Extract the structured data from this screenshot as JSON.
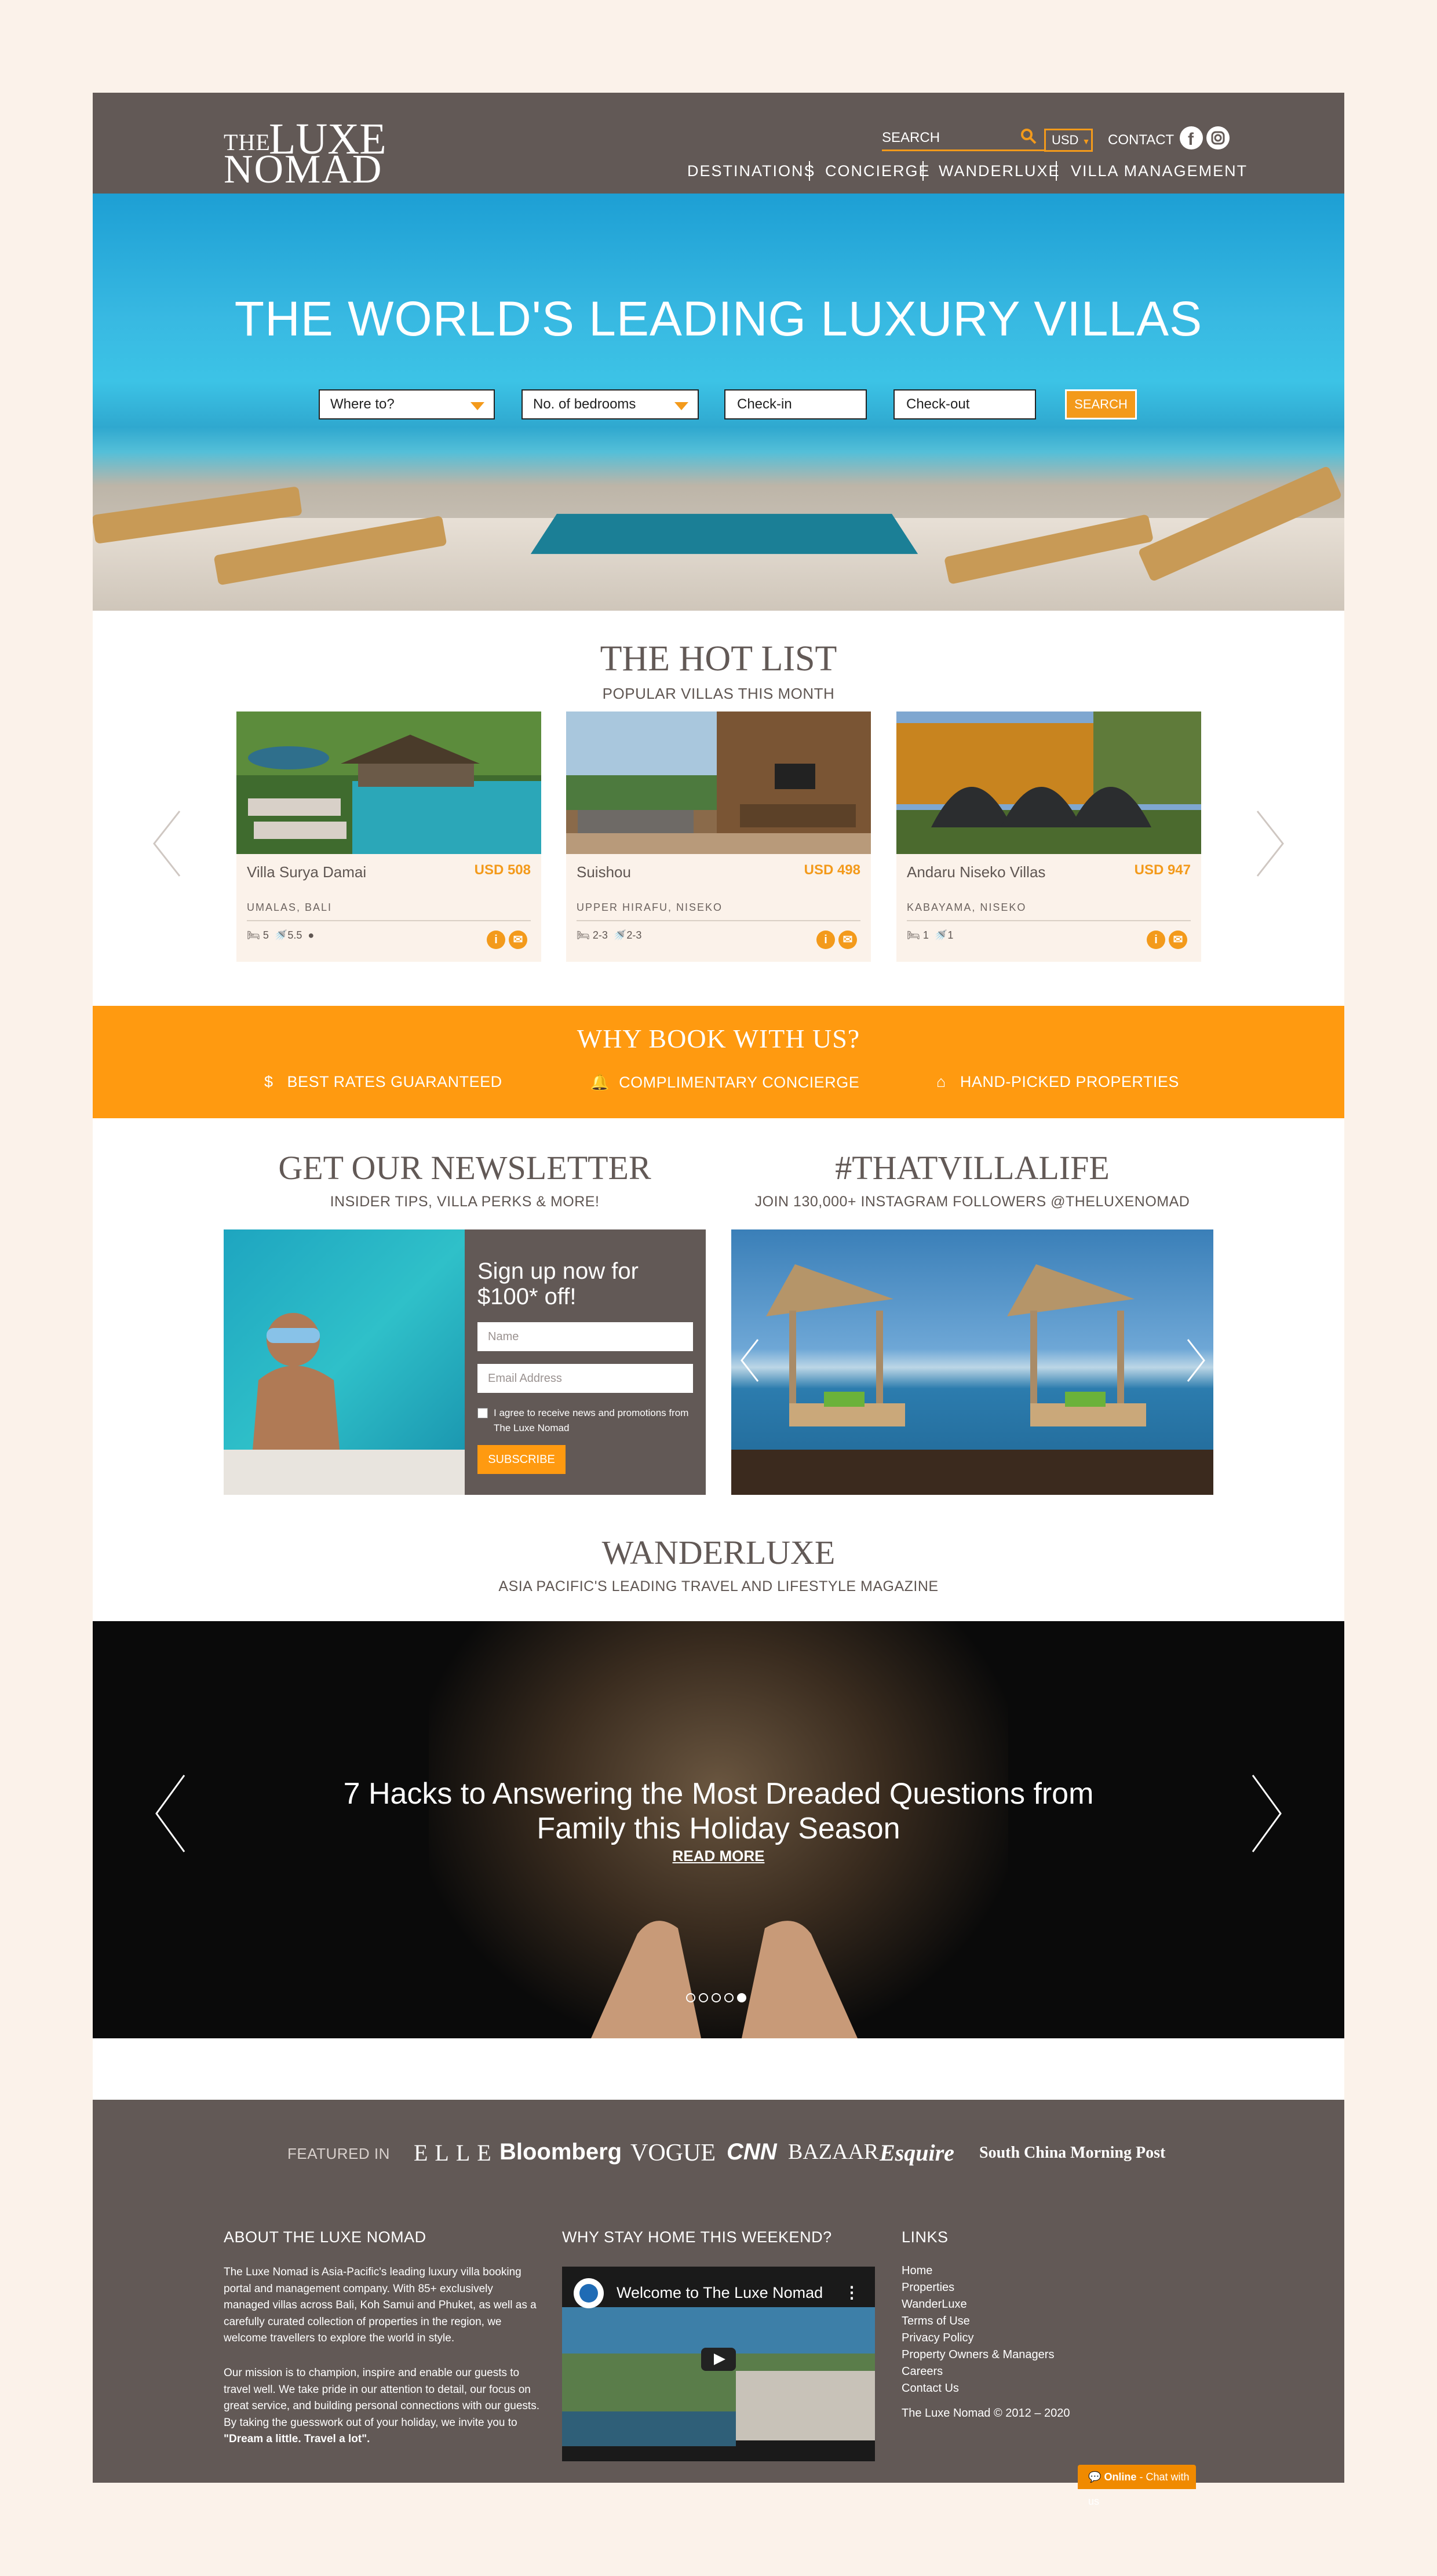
{
  "header": {
    "logo": {
      "the": "THE",
      "luxe": "LUXE",
      "nomad": "NOMAD"
    },
    "search_label": "SEARCH",
    "currency": "USD",
    "contact": "CONTACT",
    "nav": [
      "DESTINATIONS",
      "CONCIERGE",
      "WANDERLUXE",
      "VILLA MANAGEMENT"
    ]
  },
  "hero": {
    "title": "THE WORLD'S LEADING LUXURY VILLAS",
    "where": "Where to?",
    "bedrooms": "No. of bedrooms",
    "checkin": "Check-in",
    "checkout": "Check-out",
    "search_button": "SEARCH"
  },
  "hotlist": {
    "title": "THE HOT LIST",
    "subtitle": "POPULAR VILLAS THIS MONTH",
    "cards": [
      {
        "name": "Villa Surya Damai",
        "price": "USD 508",
        "location": "UMALAS, BALI",
        "beds": "5",
        "baths": "5.5"
      },
      {
        "name": "Suishou",
        "price": "USD 498",
        "location": "UPPER HIRAFU, NISEKO",
        "beds": "2-3",
        "baths": "2-3"
      },
      {
        "name": "Andaru Niseko Villas",
        "price": "USD 947",
        "location": "KABAYAMA, NISEKO",
        "beds": "1",
        "baths": "1"
      }
    ]
  },
  "why": {
    "title": "WHY BOOK WITH US?",
    "items": [
      "BEST RATES GUARANTEED",
      "COMPLIMENTARY CONCIERGE",
      "HAND-PICKED PROPERTIES"
    ]
  },
  "newsletter": {
    "title": "GET OUR NEWSLETTER",
    "subtitle": "INSIDER TIPS, VILLA PERKS & MORE!",
    "heading": "Sign up now for $100* off!",
    "name_placeholder": "Name",
    "email_placeholder": "Email Address",
    "agree": "I agree to receive news and promotions from The Luxe Nomad",
    "subscribe": "SUBSCRIBE"
  },
  "instagram": {
    "title": "#THATVILLALIFE",
    "subtitle": "JOIN 130,000+ INSTAGRAM FOLLOWERS @THELUXENOMAD"
  },
  "wanderluxe": {
    "title": "WANDERLUXE",
    "subtitle": "ASIA PACIFIC'S LEADING TRAVEL AND LIFESTYLE MAGAZINE",
    "headline": "7 Hacks to Answering the Most Dreaded Questions from Family this Holiday Season",
    "read_more": "READ MORE",
    "slides": 5,
    "active_slide": 5
  },
  "footer": {
    "featured_in": "FEATURED IN",
    "brands": [
      "ELLE",
      "Bloomberg",
      "VOGUE",
      "CNN",
      "BAZAAR",
      "Esquire",
      "South China Morning Post"
    ],
    "about_title": "ABOUT THE LUXE NOMAD",
    "about_p1": "The Luxe Nomad is Asia-Pacific's leading luxury villa booking portal and management company. With 85+ exclusively managed villas across Bali, Koh Samui and Phuket, as well as a carefully curated collection of properties in the region, we welcome travellers to explore the world in style.",
    "about_p2": "Our mission is to champion, inspire and enable our guests to travel well. We take pride in our attention to detail, our focus on great service, and building personal connections with our guests. By taking the guesswork out of your holiday, we invite you to ",
    "about_p2_bold": "\"Dream a little. Travel a lot\".",
    "weekend_title": "WHY STAY HOME THIS WEEKEND?",
    "video_title": "Welcome to The Luxe Nomad",
    "links_title": "LINKS",
    "links": [
      "Home",
      "Properties",
      "WanderLuxe",
      "Terms of Use",
      "Privacy Policy",
      "Property Owners & Managers",
      "Careers",
      "Contact Us"
    ],
    "copyright": "The Luxe Nomad © 2012 – 2020"
  },
  "chat": {
    "online": "Online",
    "label": " - Chat with us"
  },
  "colors": {
    "accent": "#ff9a10",
    "brown": "#625956",
    "cream": "#fbf2ea"
  }
}
